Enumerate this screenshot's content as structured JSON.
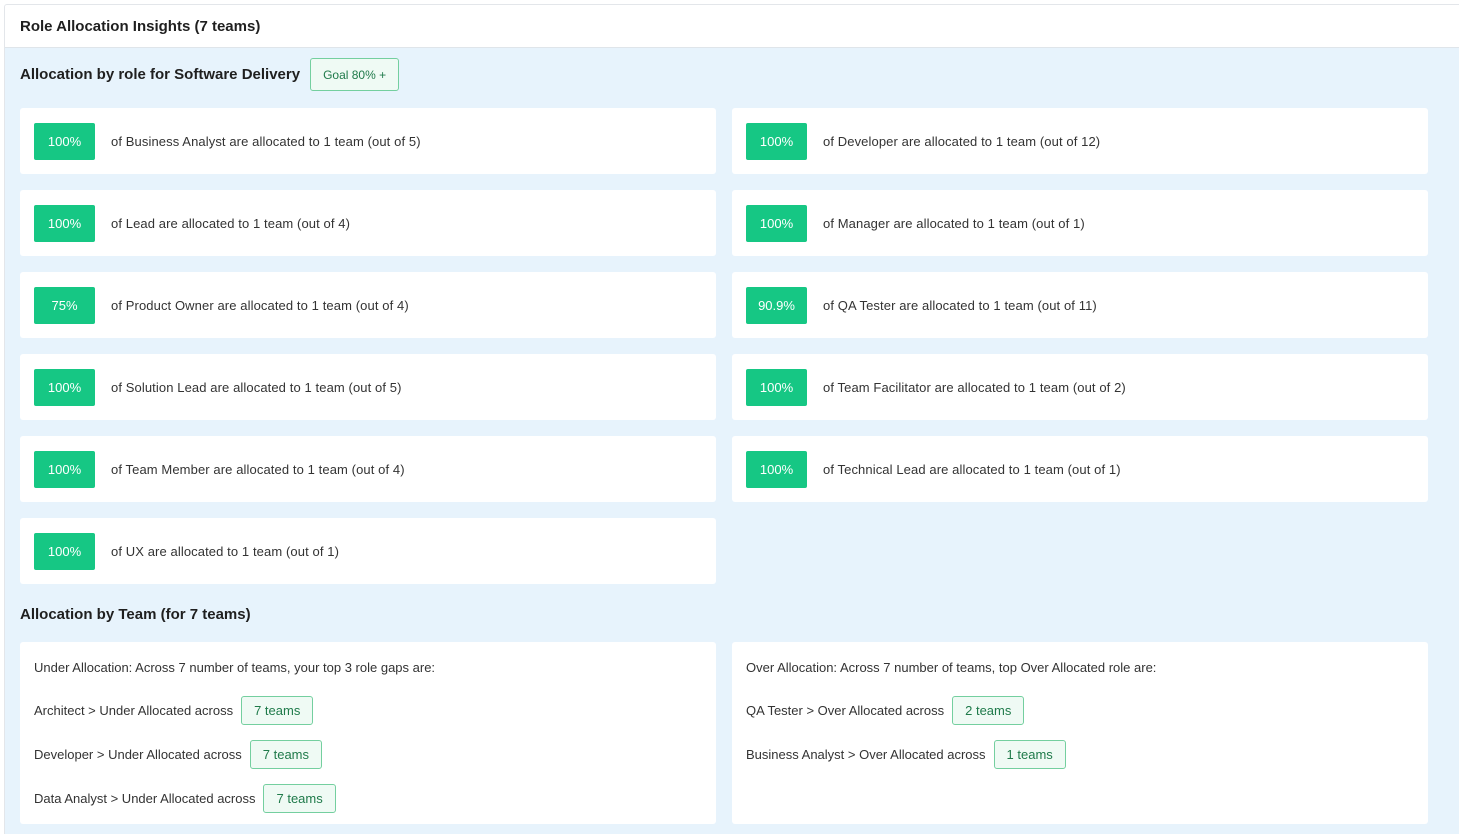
{
  "header": {
    "title": "Role Allocation Insights (7 teams)"
  },
  "role_section": {
    "title": "Allocation by role for Software Delivery",
    "goal_badge": "Goal 80% +",
    "cards": [
      {
        "pct": "100%",
        "text": "of Business Analyst are allocated to 1 team (out of 5)"
      },
      {
        "pct": "100%",
        "text": "of Developer are allocated to 1 team (out of 12)"
      },
      {
        "pct": "100%",
        "text": "of Lead are allocated to 1 team (out of 4)"
      },
      {
        "pct": "100%",
        "text": "of Manager are allocated to 1 team (out of 1)"
      },
      {
        "pct": "75%",
        "text": "of Product Owner are allocated to 1 team (out of 4)"
      },
      {
        "pct": "90.9%",
        "text": "of QA Tester are allocated to 1 team (out of 11)"
      },
      {
        "pct": "100%",
        "text": "of Solution Lead are allocated to 1 team (out of 5)"
      },
      {
        "pct": "100%",
        "text": "of Team Facilitator are allocated to 1 team (out of 2)"
      },
      {
        "pct": "100%",
        "text": "of Team Member are allocated to 1 team (out of 4)"
      },
      {
        "pct": "100%",
        "text": "of Technical Lead are allocated to 1 team (out of 1)"
      },
      {
        "pct": "100%",
        "text": "of UX are allocated to 1 team (out of 1)"
      }
    ]
  },
  "team_section": {
    "title": "Allocation by Team (for 7 teams)",
    "under": {
      "intro": "Under Allocation: Across 7 number of teams, your top 3 role gaps are:",
      "rows": [
        {
          "label": "Architect > Under Allocated across",
          "badge": "7 teams"
        },
        {
          "label": "Developer > Under Allocated across",
          "badge": "7 teams"
        },
        {
          "label": "Data Analyst > Under Allocated across",
          "badge": "7 teams"
        }
      ]
    },
    "over": {
      "intro": "Over Allocation: Across 7 number of teams, top Over Allocated role are:",
      "rows": [
        {
          "label": "QA Tester > Over Allocated across",
          "badge": "2 teams"
        },
        {
          "label": "Business Analyst > Over Allocated across",
          "badge": "1 teams"
        }
      ]
    }
  },
  "colors": {
    "panel_bg": "#e7f3fc",
    "pct_badge": "#16c784",
    "badge_border": "#74cf9f",
    "badge_bg": "#effaf4",
    "badge_text": "#1f7a4a"
  }
}
